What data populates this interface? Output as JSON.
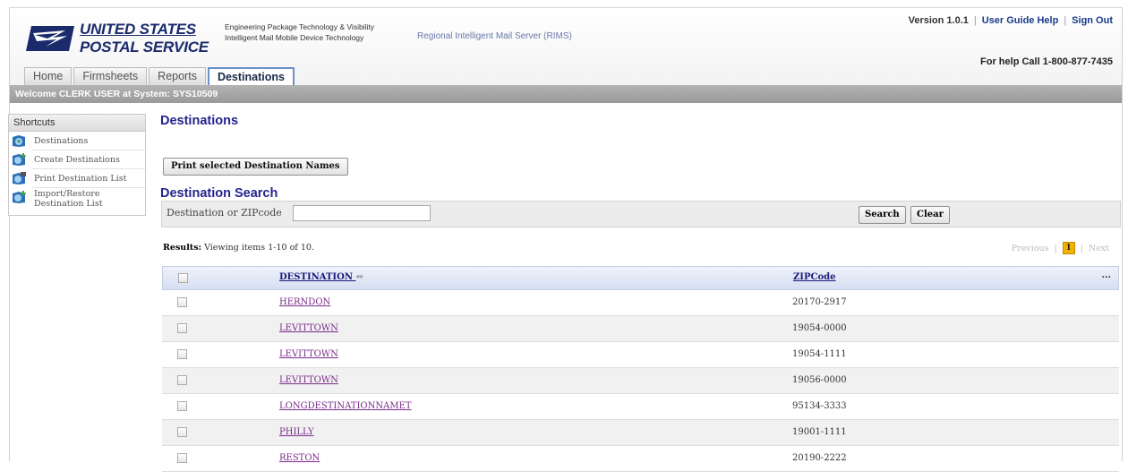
{
  "header": {
    "logo_line1": "UNITED STATES",
    "logo_line2": "POSTAL SERVICE",
    "subtitle_1": "Engineering Package Technology & Visibility",
    "subtitle_2": "Intelligent Mail Mobile Device Technology",
    "app_name": "Regional Intelligent Mail Server (RIMS)",
    "version": "Version 1.0.1",
    "user_guide": "User Guide Help",
    "sign_out": "Sign Out",
    "help_call": "For help Call 1-800-877-7435"
  },
  "tabs": [
    {
      "label": "Home"
    },
    {
      "label": "Firmsheets"
    },
    {
      "label": "Reports"
    },
    {
      "label": "Destinations",
      "active": true
    }
  ],
  "welcome": "Welcome CLERK USER at System: SYS10509",
  "shortcuts": {
    "title": "Shortcuts",
    "items": [
      {
        "label": "Destinations",
        "icon": "globe-icon"
      },
      {
        "label": "Create Destinations",
        "icon": "globe-add-icon"
      },
      {
        "label": "Print Destination List",
        "icon": "globe-print-icon"
      },
      {
        "label_1": "Import/Restore",
        "label_2": "Destination List",
        "icon": "globe-add-icon"
      }
    ]
  },
  "main": {
    "title": "Destinations",
    "print_button": "Print selected Destination Names",
    "search_title": "Destination Search",
    "search_label": "Destination or ZIPcode",
    "search_value": "",
    "search_button": "Search",
    "clear_button": "Clear"
  },
  "results": {
    "prefix": "Results:",
    "text": "Viewing items 1-10 of 10.",
    "previous": "Previous",
    "current_page": "1",
    "next": "Next"
  },
  "table": {
    "col_destination": "DESTINATION",
    "col_zip": "ZIPCode",
    "col_more": "...",
    "rows": [
      {
        "destination": "HERNDON",
        "zip": "20170-2917"
      },
      {
        "destination": "LEVITTOWN",
        "zip": "19054-0000"
      },
      {
        "destination": "LEVITTOWN",
        "zip": "19054-1111"
      },
      {
        "destination": "LEVITTOWN",
        "zip": "19056-0000"
      },
      {
        "destination": "LONGDESTINATIONNAMET",
        "zip": "95134-3333"
      },
      {
        "destination": "PHILLY",
        "zip": "19001-1111"
      },
      {
        "destination": "RESTON",
        "zip": "20190-2222"
      }
    ]
  },
  "colors": {
    "brand_navy": "#1a2a6b",
    "title_blue": "#24248f",
    "link_purple": "#7a2b8a",
    "welcome_bar": "#a3a3a3",
    "pager_current": "#f0b400"
  }
}
